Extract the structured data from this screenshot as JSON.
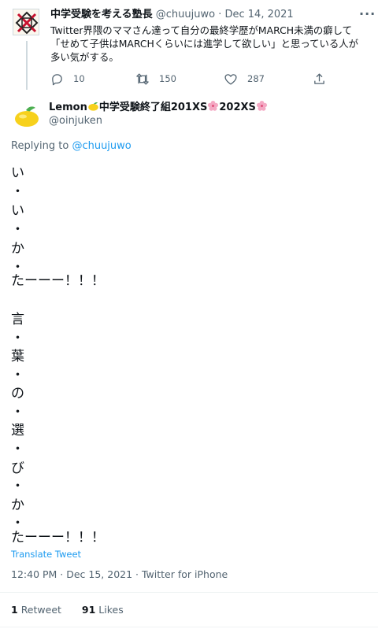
{
  "parent_tweet": {
    "display_name": "中学受験を考える塾長",
    "handle": "@chuujuwo",
    "separator": " · ",
    "date": "Dec 14, 2021",
    "text": "Twitter界隈のママさん達って自分の最終学歴がMARCH未満の癖して「せめて子供はMARCHくらいには進学して欲しい」と思っている人が多い気がする。",
    "replies": "10",
    "retweets": "150",
    "likes": "287",
    "more_icon": "more-icon",
    "reply_icon": "reply-icon",
    "retweet_icon": "retweet-icon",
    "like_icon": "heart-icon",
    "share_icon": "share-icon"
  },
  "reply_tweet": {
    "display_name_prefix": "Lemon",
    "display_name_main": "中学受験終了組201XS",
    "display_name_mid": "202XS",
    "handle": "@oinjuken",
    "replying_label": "Replying to",
    "replying_handle": "@chuujuwo",
    "lines": [
      "い",
      "・",
      "い",
      "・",
      "か",
      "・",
      "たーーー！！！",
      "",
      "言",
      "・",
      "葉",
      "・",
      "の",
      "・",
      "選",
      "・",
      "び",
      "・",
      "か",
      "・",
      "たーーー！！！"
    ],
    "translate_label": "Translate Tweet",
    "timestamp": "12:40 PM · Dec 15, 2021 · Twitter for iPhone",
    "retweet_count": "1",
    "retweet_label": "Retweet",
    "like_count": "91",
    "like_label": "Likes"
  },
  "colors": {
    "text": "#0f1419",
    "secondary": "#536471",
    "link": "#1d9bf0",
    "divider": "#eff3f4",
    "lemon": "#f7d11c",
    "blossom": "#f4a9c4"
  }
}
